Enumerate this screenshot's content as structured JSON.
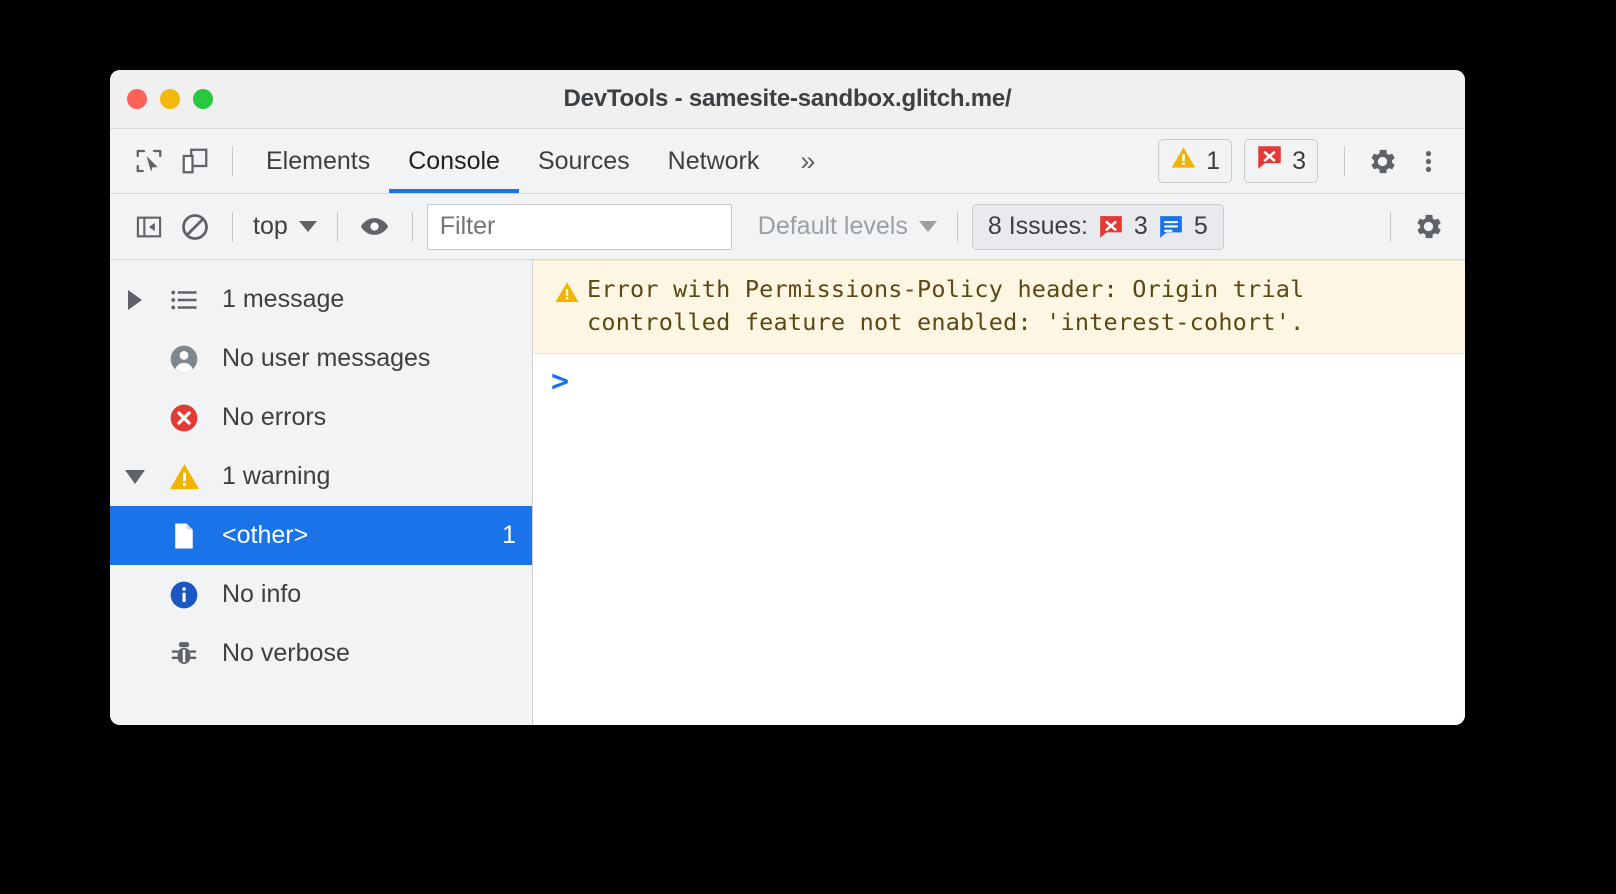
{
  "window": {
    "title": "DevTools - samesite-sandbox.glitch.me/",
    "traffic_lights": [
      {
        "name": "close",
        "color": "#ff6058"
      },
      {
        "name": "minimize",
        "color": "#f0b90b"
      },
      {
        "name": "maximize",
        "color": "#28c840"
      }
    ]
  },
  "tabbar": {
    "inspect_icon": "inspect-element-icon",
    "device_icon": "device-toolbar-icon",
    "tabs": [
      {
        "label": "Elements",
        "active": false
      },
      {
        "label": "Console",
        "active": true
      },
      {
        "label": "Sources",
        "active": false
      },
      {
        "label": "Network",
        "active": false
      }
    ],
    "more_tabs_label": "»",
    "warning_count": "1",
    "error_count": "3",
    "settings_icon": "gear-icon",
    "more_options_icon": "kebab-menu-icon"
  },
  "filterbar": {
    "sidebar_toggle_icon": "console-sidebar-toggle-icon",
    "clear_console_icon": "clear-console-icon",
    "context_label": "top",
    "live_expression_icon": "eye-icon",
    "filter_placeholder": "Filter",
    "filter_value": "",
    "levels_label": "Default levels",
    "issues_label": "8 Issues:",
    "issues_error_count": "3",
    "issues_info_count": "5",
    "settings_icon": "gear-icon"
  },
  "sidebar": {
    "items": [
      {
        "label": "1 message",
        "icon": "list-icon",
        "twisty": "right",
        "count": "",
        "selected": false,
        "child": false
      },
      {
        "label": "No user messages",
        "icon": "user-icon",
        "twisty": "none",
        "count": "",
        "selected": false,
        "child": false
      },
      {
        "label": "No errors",
        "icon": "error-icon",
        "twisty": "none",
        "count": "",
        "selected": false,
        "child": false
      },
      {
        "label": "1 warning",
        "icon": "warning-icon",
        "twisty": "down",
        "count": "",
        "selected": false,
        "child": false
      },
      {
        "label": "<other>",
        "icon": "file-icon",
        "twisty": "none",
        "count": "1",
        "selected": true,
        "child": true
      },
      {
        "label": "No info",
        "icon": "info-icon",
        "twisty": "none",
        "count": "",
        "selected": false,
        "child": false
      },
      {
        "label": "No verbose",
        "icon": "bug-icon",
        "twisty": "none",
        "count": "",
        "selected": false,
        "child": false
      }
    ]
  },
  "console": {
    "messages": [
      {
        "level": "warning",
        "icon": "warning-icon",
        "text": "Error with Permissions-Policy header: Origin trial\ncontrolled feature not enabled: 'interest-cohort'."
      }
    ],
    "prompt_symbol": ">",
    "prompt_value": ""
  },
  "colors": {
    "accent_blue": "#1a73e8",
    "error_red": "#e53935",
    "warning_yellow": "#f0b400",
    "info_blue": "#1a56c4",
    "warning_bg": "#fdf6e3",
    "chrome_bg": "#f1f3f4"
  }
}
